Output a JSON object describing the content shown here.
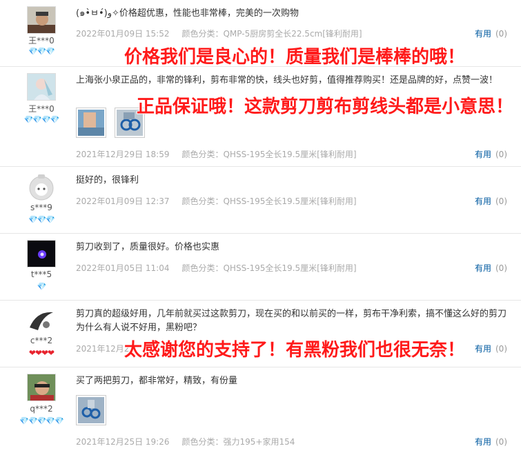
{
  "reviews": [
    {
      "user": "王***0",
      "badges": "💎💎💎",
      "content": "(๑•̀ㅂ•́)و✧价格超优惠，性能也非常棒，完美的一次购物",
      "date": "2022年01月09日 15:52",
      "spec": "颜色分类：QMP-5厨房剪全长22.5cm[锋利耐用]",
      "useful_label": "有用",
      "useful_count": "(0)"
    },
    {
      "user": "王***0",
      "badges": "💎💎💎💎",
      "content": "上海张小泉正品的，非常的锋利，剪布非常的快，线头也好剪，值得推荐购买！还是品牌的好，点赞一波！",
      "date": "2021年12月29日 18:59",
      "spec": "颜色分类：QHSS-195全长19.5厘米[锋利耐用]",
      "useful_label": "有用",
      "useful_count": "(0)"
    },
    {
      "user": "s***9",
      "badges": "💎💎💎",
      "content": "挺好的，很锋利",
      "date": "2022年01月09日 12:37",
      "spec": "颜色分类：QHSS-195全长19.5厘米[锋利耐用]",
      "useful_label": "有用",
      "useful_count": "(0)"
    },
    {
      "user": "t***5",
      "badges": "💎",
      "content": "剪刀收到了，质量很好。价格也实惠",
      "date": "2022年01月05日 11:04",
      "spec": "颜色分类：QHSS-195全长19.5厘米[锋利耐用]",
      "useful_label": "有用",
      "useful_count": "(0)"
    },
    {
      "user": "c***2",
      "badges": "❤❤❤❤",
      "content": "剪刀真的超级好用，几年前就买过这款剪刀，现在买的和以前买的一样，剪布干净利索，搞不懂这么好的剪刀为什么有人说不好用，黑粉吧？",
      "date": "2021年12月2",
      "spec": "",
      "useful_label": "有用",
      "useful_count": "(0)"
    },
    {
      "user": "q***2",
      "badges": "💎💎💎💎💎",
      "content": "买了两把剪刀，都非常好，精致，有份量",
      "date": "2021年12月25日 19:26",
      "spec": "颜色分类：强力195+家用154",
      "useful_label": "有用",
      "useful_count": "(0)"
    }
  ],
  "overlays": [
    "价格我们是良心的！质量我们是棒棒的哦！",
    "正品保证哦！这款剪刀剪布剪线头都是小意思！",
    "太感谢您的支持了！有黑粉我们也很无奈！"
  ],
  "colors": {
    "overlay": "#ff1a1a",
    "link": "#005aa0",
    "meta": "#aaaaaa",
    "gem": "#2fa6ee",
    "heart": "#e8232e"
  }
}
